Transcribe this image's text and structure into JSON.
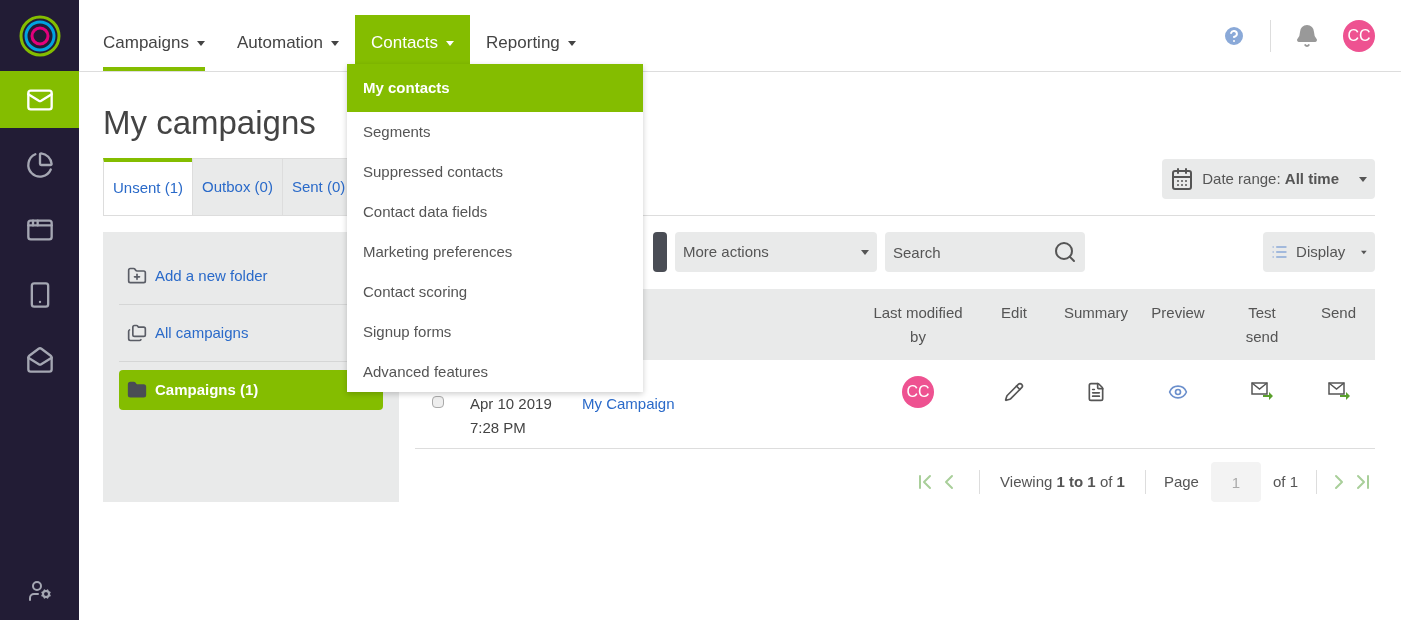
{
  "sidebar": {
    "items": [
      {
        "kind": "mail",
        "selected": true
      },
      {
        "kind": "reports",
        "selected": false
      },
      {
        "kind": "landing",
        "selected": false
      },
      {
        "kind": "sms",
        "selected": false
      },
      {
        "kind": "templates",
        "selected": false
      }
    ]
  },
  "top_nav": {
    "items": [
      {
        "label": "Campaigns",
        "selected": true,
        "open": false
      },
      {
        "label": "Automation",
        "selected": false,
        "open": false
      },
      {
        "label": "Contacts",
        "selected": false,
        "open": true
      },
      {
        "label": "Reporting",
        "selected": false,
        "open": false
      }
    ]
  },
  "dropdown": {
    "items": [
      {
        "label": "My contacts",
        "selected": true
      },
      {
        "label": "Segments",
        "selected": false
      },
      {
        "label": "Suppressed contacts",
        "selected": false
      },
      {
        "label": "Contact data fields",
        "selected": false
      },
      {
        "label": "Marketing preferences",
        "selected": false
      },
      {
        "label": "Contact scoring",
        "selected": false
      },
      {
        "label": "Signup forms",
        "selected": false
      },
      {
        "label": "Advanced features",
        "selected": false
      }
    ]
  },
  "user": {
    "initials": "CC"
  },
  "page_title": "My campaigns",
  "tabs": [
    {
      "label": "Unsent (1)",
      "selected": true
    },
    {
      "label": "Outbox (0)",
      "selected": false
    },
    {
      "label": "Sent (0)",
      "selected": false
    }
  ],
  "date_range": {
    "label": "Date range:",
    "value": "All time"
  },
  "folders": [
    {
      "label": "Add a new folder",
      "kind": "add",
      "selected": false
    },
    {
      "label": "All campaigns",
      "kind": "all",
      "selected": false
    },
    {
      "label": "Campaigns (1)",
      "kind": "folder",
      "selected": true
    }
  ],
  "toolbar": {
    "more_actions": "More actions",
    "search_placeholder": "Search",
    "display": "Display"
  },
  "table": {
    "columns": [
      "Last modified by",
      "Edit",
      "Summary",
      "Preview",
      "Test send",
      "Send"
    ],
    "rows": [
      {
        "checked": false,
        "date": "Apr 10 2019",
        "time": "7:28 PM",
        "name": "My Campaign",
        "modified_by": "CC"
      }
    ]
  },
  "pagination": {
    "viewing": "Viewing **1 to 1** of **1**",
    "page_label": "Page",
    "page_value": "1",
    "page_total": "of 1"
  }
}
